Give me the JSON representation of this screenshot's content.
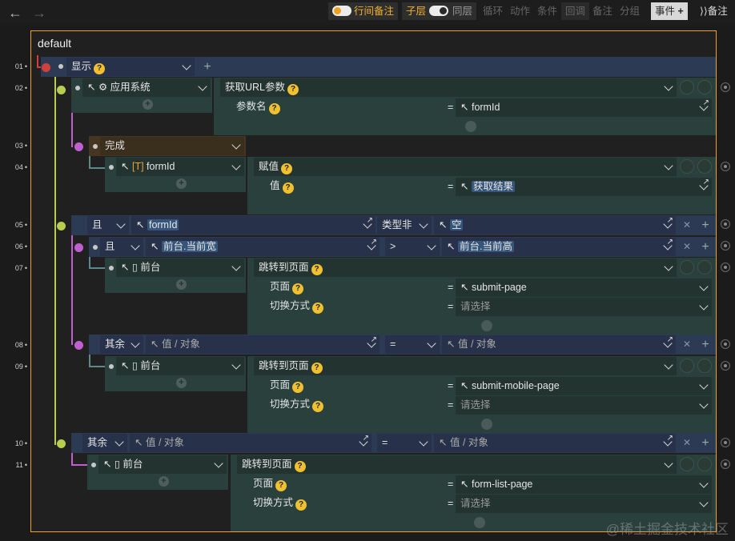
{
  "toolbar": {
    "inline_comment": "行间备注",
    "child_layer": "子层",
    "same_layer": "同层",
    "loop": "循环",
    "action": "动作",
    "condition": "条件",
    "callback": "回调",
    "note": "备注",
    "group": "分组",
    "event": "事件",
    "comment": "备注"
  },
  "canvas_title": "default",
  "callback_tag": "回调",
  "line_numbers": [
    "01",
    "02",
    "03",
    "04",
    "05",
    "06",
    "07",
    "08",
    "09",
    "10",
    "11"
  ],
  "rows": {
    "r01": {
      "show": "显示"
    },
    "r02": {
      "target": "应用系统",
      "method": "获取URL参数",
      "param_label": "参数名",
      "param_value": "formId"
    },
    "r03": {
      "event": "完成"
    },
    "r04": {
      "target": "formId",
      "method": "赋值",
      "param_label": "值",
      "param_value": "获取结果"
    },
    "r05": {
      "logic": "且",
      "left": "formId",
      "op": "类型非",
      "right": "空"
    },
    "r06": {
      "logic": "且",
      "left": "前台.当前宽",
      "op": ">",
      "right": "前台.当前高"
    },
    "r07": {
      "target": "前台",
      "method": "跳转到页面",
      "page_label": "页面",
      "page_value": "submit-page",
      "mode_label": "切换方式",
      "mode_placeholder": "请选择"
    },
    "r08": {
      "logic": "其余",
      "left": "值 / 对象",
      "op": "=",
      "right": "值 / 对象"
    },
    "r09": {
      "target": "前台",
      "method": "跳转到页面",
      "page_label": "页面",
      "page_value": "submit-mobile-page",
      "mode_label": "切换方式",
      "mode_placeholder": "请选择"
    },
    "r10": {
      "logic": "其余",
      "left": "值 / 对象",
      "op": "=",
      "right": "值 / 对象"
    },
    "r11": {
      "target": "前台",
      "method": "跳转到页面",
      "page_label": "页面",
      "page_value": "form-list-page",
      "mode_label": "切换方式",
      "mode_placeholder": "请选择"
    }
  },
  "eq": "=",
  "watermark": "@稀土掘金技术社区",
  "colors": {
    "accent": "#f0a030",
    "condition_bar": "#2d3a53",
    "action_block": "#29403d",
    "event_block": "#453521",
    "node_yellow": "#b8cd50",
    "node_purple": "#c060d0",
    "node_red": "#d04040"
  }
}
